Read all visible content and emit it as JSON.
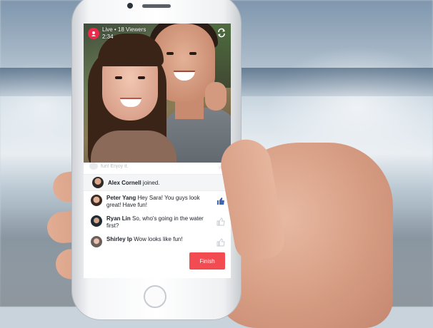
{
  "live": {
    "status": "Live • 18 Viewers",
    "timer": "2:34"
  },
  "comments": {
    "faded_text": "fun! Enjoy it.",
    "joined": {
      "name": "Alex Cornell",
      "text": "joined."
    },
    "items": [
      {
        "name": "Peter Yang",
        "text": "Hey Sara! You guys look great! Have fun!",
        "liked": true
      },
      {
        "name": "Ryan Lin",
        "text": "So, who's going in the water first?",
        "liked": false
      },
      {
        "name": "Shirley Ip",
        "text": "Wow looks like fun!",
        "liked": false
      }
    ]
  },
  "actions": {
    "finish_label": "Finish"
  },
  "colors": {
    "accent": "#f24c52",
    "live_red": "#f0284a",
    "like_blue": "#4267b2",
    "like_gray": "#c5c9cf"
  },
  "icons": [
    "live-icon",
    "switch-camera-icon",
    "like-icon"
  ]
}
